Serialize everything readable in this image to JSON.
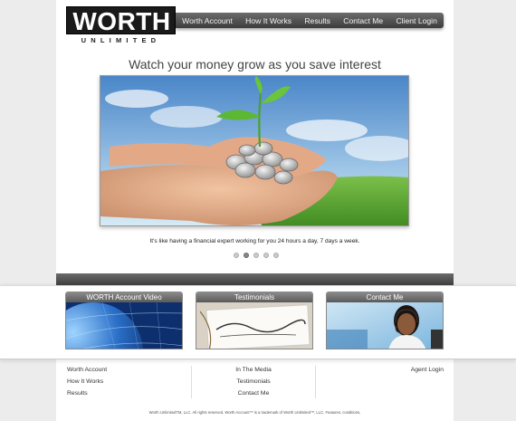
{
  "logo": {
    "word": "WORTH",
    "sub": "UNLIMITED"
  },
  "nav": [
    "Worth Account",
    "How It Works",
    "Results",
    "Contact Me",
    "Client Login"
  ],
  "headline": "Watch your money grow as you save interest",
  "caption": "It's like having a financial expert working for you 24 hours a day, 7 days a week.",
  "slider": {
    "count": 5,
    "active_index": 1
  },
  "cards": [
    {
      "title": "WORTH Account Video",
      "icon": "globe-image"
    },
    {
      "title": "Testimonials",
      "icon": "testimonials-note-image"
    },
    {
      "title": "Contact Me",
      "icon": "agent-headset-image"
    }
  ],
  "footer": {
    "col1": [
      "Worth Account",
      "How It Works",
      "Results"
    ],
    "col2": [
      "In The Media",
      "Testimonials",
      "Contact Me"
    ],
    "col3": [
      "Agent Login"
    ]
  },
  "copyright": "Worth UnlimitedTM, LLC. All rights reserved. Worth Account™ is a trademark of Worth Unlimited™, LLC. Features, conditions,",
  "colors": {
    "nav": "#4a4a4a",
    "band": "#555555",
    "background": "#ececec"
  }
}
